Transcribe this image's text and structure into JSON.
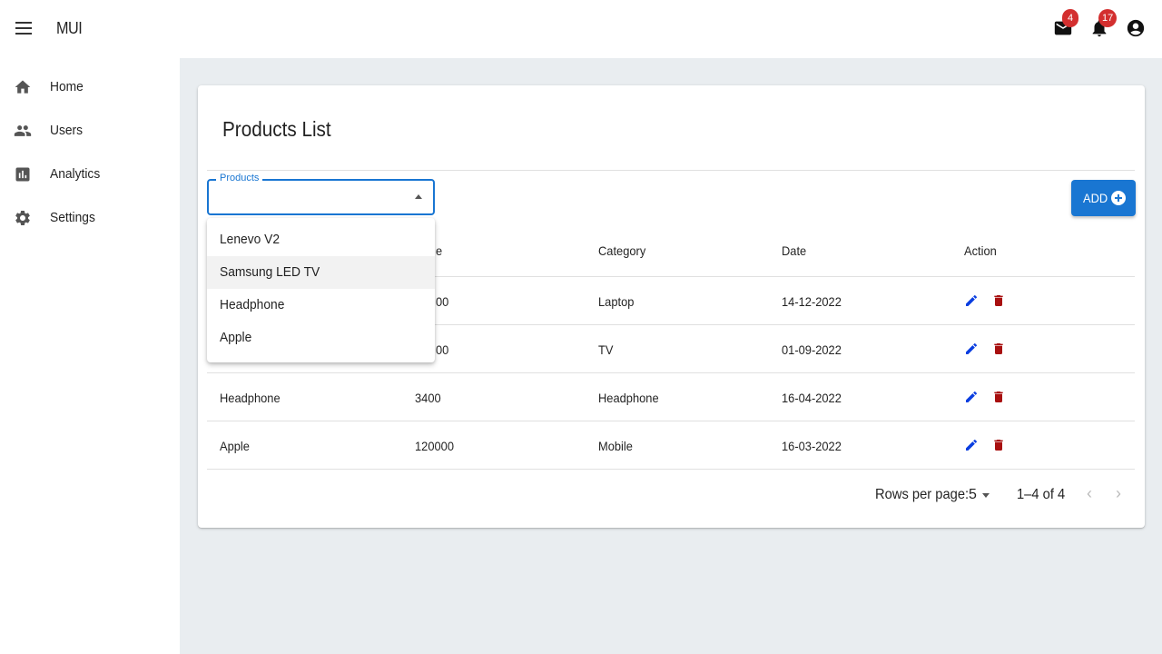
{
  "appbar": {
    "title": "MUI",
    "mail_badge": "4",
    "notifications_badge": "17"
  },
  "sidebar": {
    "items": [
      {
        "label": "Home",
        "icon": "home-icon"
      },
      {
        "label": "Users",
        "icon": "users-icon"
      },
      {
        "label": "Analytics",
        "icon": "analytics-icon"
      },
      {
        "label": "Settings",
        "icon": "settings-icon"
      }
    ]
  },
  "card": {
    "title": "Products List",
    "select_label": "Products",
    "add_label": "ADD"
  },
  "table": {
    "headers": [
      "e",
      "Category",
      "Date",
      "Action"
    ],
    "rows": [
      {
        "name": "",
        "price": "00",
        "category": "Laptop",
        "date": "14-12-2022"
      },
      {
        "name": "",
        "price": "00",
        "category": "TV",
        "date": "01-09-2022"
      },
      {
        "name": "Headphone",
        "price": "3400",
        "category": "Headphone",
        "date": "16-04-2022"
      },
      {
        "name": "Apple",
        "price": "120000",
        "category": "Mobile",
        "date": "16-03-2022"
      }
    ]
  },
  "pagination": {
    "rows_label": "Rows per page:",
    "rows_value": "5",
    "range": "1–4 of 4",
    "prev": "‹",
    "next": "›"
  },
  "dropdown": {
    "options": [
      "Lenevo V2",
      "Samsung LED TV",
      "Headphone",
      "Apple"
    ],
    "highlighted_index": 1
  },
  "colors": {
    "primary": "#1976d2",
    "badge": "#d32f2f",
    "edit": "#0a3ee0",
    "delete": "#a81010",
    "background": "#e9edf0"
  }
}
